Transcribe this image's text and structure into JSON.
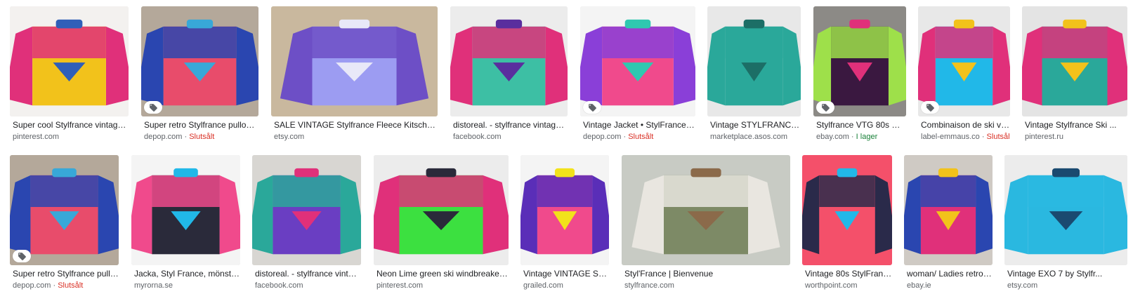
{
  "results": [
    {
      "title": "Super cool Stylfrance vintage 8...",
      "source": "pinterest.com",
      "status": "",
      "status_type": "",
      "shopping": false,
      "colors": [
        "#f3f1ef",
        "#f2c21b",
        "#e0307a",
        "#2f5fb8"
      ]
    },
    {
      "title": "Super retro Stylfrance pullover s...",
      "source": "depop.com",
      "status": "Slutsålt",
      "status_type": "sold",
      "shopping": true,
      "colors": [
        "#b4a89a",
        "#e84c6b",
        "#2a46b0",
        "#38a8d8"
      ]
    },
    {
      "title": "SALE VINTAGE Stylfrance Fleece Kitsch Blue ...",
      "source": "etsy.com",
      "status": "",
      "status_type": "",
      "shopping": false,
      "colors": [
        "#c9b89e",
        "#9c9cf2",
        "#6d4fc6",
        "#e8e8f8"
      ]
    },
    {
      "title": "distoreal. - stylfrance vintage ja...",
      "source": "facebook.com",
      "status": "",
      "status_type": "",
      "shopping": false,
      "colors": [
        "#ececec",
        "#3dbfa4",
        "#e0307a",
        "#5a2e9e"
      ]
    },
    {
      "title": "Vintage Jacket • StylFrance • V...",
      "source": "depop.com",
      "status": "Slutsålt",
      "status_type": "sold",
      "shopping": true,
      "colors": [
        "#f4f4f4",
        "#f04a8c",
        "#8a3fd8",
        "#2fc8b0"
      ]
    },
    {
      "title": "Vintage STYLFRANCE Fu...",
      "source": "marketplace.asos.com",
      "status": "",
      "status_type": "",
      "shopping": false,
      "colors": [
        "#e8e8e8",
        "#2aa89a",
        "#2aa89a",
        "#1c6e66"
      ]
    },
    {
      "title": "Stylfrance VTG 80s RAR...",
      "source": "ebay.com",
      "status": "I lager",
      "status_type": "stock",
      "shopping": true,
      "colors": [
        "#8c8a86",
        "#3a1840",
        "#9ee04a",
        "#e0307a"
      ]
    },
    {
      "title": "Combinaison de ski vint...",
      "source": "label-emmaus.co",
      "status": "Slutsålt",
      "status_type": "sold",
      "shopping": true,
      "colors": [
        "#e8e8e8",
        "#21b8e8",
        "#e0307a",
        "#f2c21b"
      ]
    },
    {
      "title": "Vintage Stylfrance Ski ...",
      "source": "pinterest.ru",
      "status": "",
      "status_type": "",
      "shopping": false,
      "colors": [
        "#e4e4e4",
        "#2aa89a",
        "#e0307a",
        "#f2c21b"
      ]
    },
    {
      "title": "Super retro Stylfrance pullov...",
      "source": "depop.com",
      "status": "Slutsålt",
      "status_type": "sold",
      "shopping": true,
      "colors": [
        "#b4a89a",
        "#e84c6b",
        "#2a46b0",
        "#38a8d8"
      ]
    },
    {
      "title": "Jacka, Styl France, mönstrad,...",
      "source": "myrorna.se",
      "status": "",
      "status_type": "",
      "shopping": false,
      "colors": [
        "#f4f4f4",
        "#2a2a3a",
        "#f04a8c",
        "#21b8e8"
      ]
    },
    {
      "title": "distoreal. - stylfrance vintage...",
      "source": "facebook.com",
      "status": "",
      "status_type": "",
      "shopping": false,
      "colors": [
        "#d8d6d2",
        "#6a3ec2",
        "#2aa89a",
        "#e0307a"
      ]
    },
    {
      "title": "Neon Lime green ski windbreaker vin...",
      "source": "pinterest.com",
      "status": "",
      "status_type": "",
      "shopping": false,
      "colors": [
        "#ececec",
        "#3ce040",
        "#e0307a",
        "#2a2a3a"
      ]
    },
    {
      "title": "Vintage VINTAGE STYL...",
      "source": "grailed.com",
      "status": "",
      "status_type": "",
      "shopping": false,
      "colors": [
        "#f4f4f4",
        "#f04a8c",
        "#5a2eb8",
        "#f2e21b"
      ]
    },
    {
      "title": "Styl'France | Bienvenue",
      "source": "stylfrance.com",
      "status": "",
      "status_type": "",
      "shopping": false,
      "colors": [
        "#c8cbc4",
        "#7d8a66",
        "#e9e6e0",
        "#8b6a4a"
      ]
    },
    {
      "title": "Vintage 80s StylFrance...",
      "source": "worthpoint.com",
      "status": "",
      "status_type": "",
      "shopping": false,
      "colors": [
        "#f4506a",
        "#f4506a",
        "#2a2a4a",
        "#21b8e8"
      ]
    },
    {
      "title": "woman/ Ladies retro St...",
      "source": "ebay.ie",
      "status": "",
      "status_type": "",
      "shopping": false,
      "colors": [
        "#cfcac4",
        "#e0307a",
        "#2a46b0",
        "#f2c21b"
      ]
    },
    {
      "title": "Vintage EXO 7 by Stylfr...",
      "source": "etsy.com",
      "status": "",
      "status_type": "",
      "shopping": false,
      "colors": [
        "#ececec",
        "#2ab8e0",
        "#2ab8e0",
        "#1a4a70"
      ]
    }
  ]
}
